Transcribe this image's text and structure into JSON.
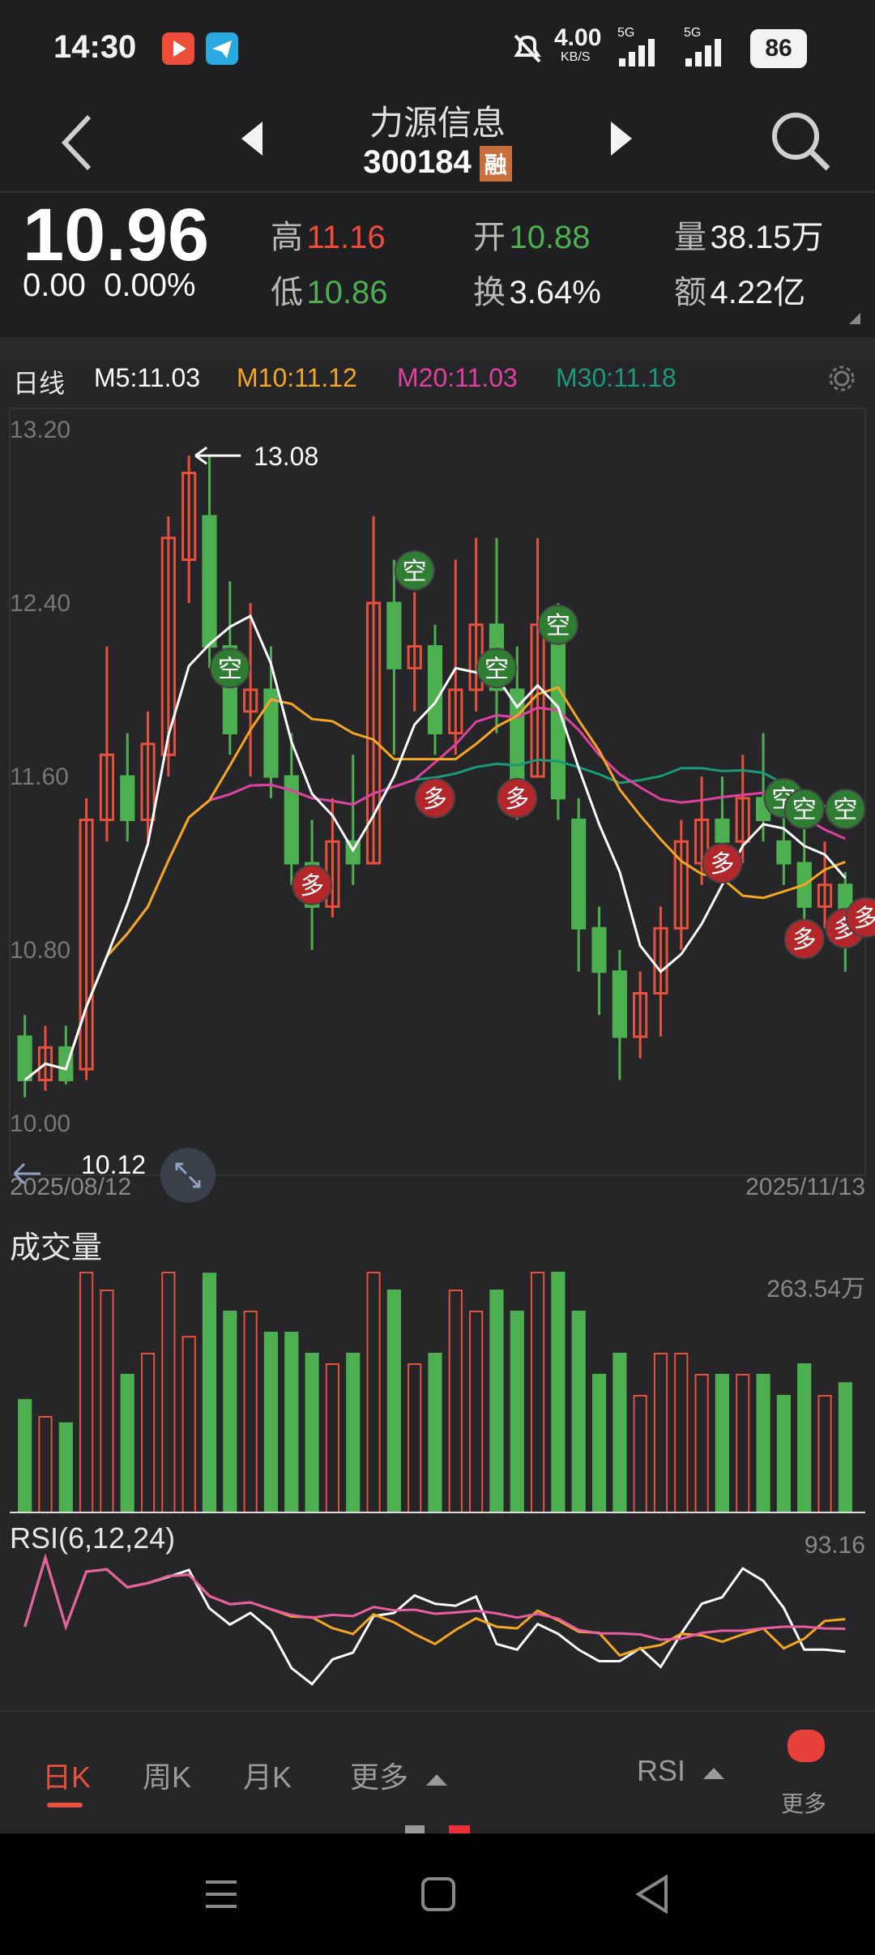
{
  "status_bar": {
    "time": "14:30",
    "net_speed": "4.00",
    "net_unit": "KB/S",
    "signal1": "5G",
    "signal2": "5G",
    "battery": "86"
  },
  "header": {
    "stock_name": "力源信息",
    "stock_code": "300184",
    "badge": "融"
  },
  "quote": {
    "price": "10.96",
    "change": "0.00",
    "change_pct": "0.00%",
    "high_label": "高",
    "high": "11.16",
    "low_label": "低",
    "low": "10.86",
    "open_label": "开",
    "open": "10.88",
    "turnover_label": "换",
    "turnover": "3.64%",
    "volume_label": "量",
    "volume": "38.15万",
    "amount_label": "额",
    "amount": "4.22亿"
  },
  "chart_header": {
    "period": "日线",
    "m5": "M5:11.03",
    "m10": "M10:11.12",
    "m20": "M20:11.03",
    "m30": "M30:11.18"
  },
  "colors": {
    "up": "#e8503e",
    "down": "#4caf50",
    "m5": "#ffffff",
    "m10": "#f5a623",
    "m20": "#e040a0",
    "m30": "#1a9a78"
  },
  "chart_data": [
    {
      "type": "candlestick",
      "y_ticks": [
        "13.20",
        "12.40",
        "11.60",
        "10.80",
        "10.00"
      ],
      "ylim": [
        10.0,
        13.2
      ],
      "max_annotation": "13.08",
      "min_annotation": "10.12",
      "start_date": "2025/08/12",
      "end_date": "2025/11/13",
      "signals": [
        {
          "label": "空",
          "x": 10,
          "y": 12.1,
          "kind": "sell"
        },
        {
          "label": "空",
          "x": 19,
          "y": 12.55,
          "kind": "sell"
        },
        {
          "label": "空",
          "x": 23,
          "y": 12.1,
          "kind": "sell"
        },
        {
          "label": "空",
          "x": 26,
          "y": 12.3,
          "kind": "sell"
        },
        {
          "label": "空",
          "x": 37,
          "y": 11.5,
          "kind": "sell"
        },
        {
          "label": "空",
          "x": 38,
          "y": 11.45,
          "kind": "sell"
        },
        {
          "label": "空",
          "x": 40,
          "y": 11.45,
          "kind": "sell"
        },
        {
          "label": "多",
          "x": 14,
          "y": 11.1,
          "kind": "buy"
        },
        {
          "label": "多",
          "x": 20,
          "y": 11.5,
          "kind": "buy"
        },
        {
          "label": "多",
          "x": 24,
          "y": 11.5,
          "kind": "buy"
        },
        {
          "label": "多",
          "x": 34,
          "y": 11.2,
          "kind": "buy"
        },
        {
          "label": "多",
          "x": 38,
          "y": 10.85,
          "kind": "buy"
        },
        {
          "label": "多",
          "x": 40,
          "y": 10.9,
          "kind": "buy"
        },
        {
          "label": "多",
          "x": 41,
          "y": 10.95,
          "kind": "buy"
        }
      ],
      "candles": [
        [
          10.4,
          10.2,
          10.5,
          10.12
        ],
        [
          10.2,
          10.35,
          10.45,
          10.15
        ],
        [
          10.35,
          10.2,
          10.45,
          10.18
        ],
        [
          10.25,
          11.4,
          11.5,
          10.2
        ],
        [
          11.4,
          11.7,
          12.2,
          11.3
        ],
        [
          11.6,
          11.4,
          11.8,
          11.3
        ],
        [
          11.4,
          11.75,
          11.9,
          11.3
        ],
        [
          11.7,
          12.7,
          12.8,
          11.6
        ],
        [
          12.6,
          13.0,
          13.08,
          12.4
        ],
        [
          12.8,
          12.2,
          13.08,
          12.1
        ],
        [
          12.2,
          11.8,
          12.5,
          11.7
        ],
        [
          11.9,
          12.0,
          12.4,
          11.6
        ],
        [
          12.0,
          11.6,
          12.2,
          11.5
        ],
        [
          11.6,
          11.2,
          11.8,
          11.1
        ],
        [
          11.2,
          11.0,
          11.4,
          10.8
        ],
        [
          11.0,
          11.3,
          11.5,
          10.95
        ],
        [
          11.3,
          11.2,
          11.7,
          11.1
        ],
        [
          11.2,
          12.4,
          12.8,
          11.2
        ],
        [
          12.4,
          12.1,
          12.6,
          11.7
        ],
        [
          12.1,
          12.2,
          12.45,
          11.9
        ],
        [
          12.2,
          11.8,
          12.3,
          11.7
        ],
        [
          11.8,
          12.0,
          12.6,
          11.7
        ],
        [
          12.0,
          12.3,
          12.7,
          11.9
        ],
        [
          12.3,
          12.0,
          12.7,
          11.8
        ],
        [
          12.0,
          11.5,
          12.2,
          11.4
        ],
        [
          11.6,
          12.3,
          12.7,
          11.6
        ],
        [
          12.3,
          11.5,
          12.4,
          11.4
        ],
        [
          11.4,
          10.9,
          11.5,
          10.7
        ],
        [
          10.9,
          10.7,
          11.0,
          10.5
        ],
        [
          10.7,
          10.4,
          10.8,
          10.2
        ],
        [
          10.4,
          10.6,
          10.7,
          10.3
        ],
        [
          10.6,
          10.9,
          11.0,
          10.4
        ],
        [
          10.9,
          11.3,
          11.4,
          10.8
        ],
        [
          11.2,
          11.4,
          11.6,
          11.1
        ],
        [
          11.4,
          11.3,
          11.6,
          11.1
        ],
        [
          11.3,
          11.5,
          11.7,
          11.2
        ],
        [
          11.5,
          11.4,
          11.8,
          11.3
        ],
        [
          11.3,
          11.2,
          11.5,
          11.1
        ],
        [
          11.2,
          11.0,
          11.4,
          10.85
        ],
        [
          11.0,
          11.1,
          11.3,
          10.9
        ],
        [
          11.1,
          10.96,
          11.16,
          10.7
        ]
      ]
    },
    {
      "type": "bar",
      "title": "成交量",
      "max_label": "263.54万"
    },
    {
      "type": "line",
      "title": "RSI(6,12,24)",
      "max_label": "93.16"
    }
  ],
  "bottom_tabs": {
    "day": "日K",
    "week": "周K",
    "month": "月K",
    "more": "更多",
    "indicator": "RSI",
    "more_btn": "更多"
  }
}
